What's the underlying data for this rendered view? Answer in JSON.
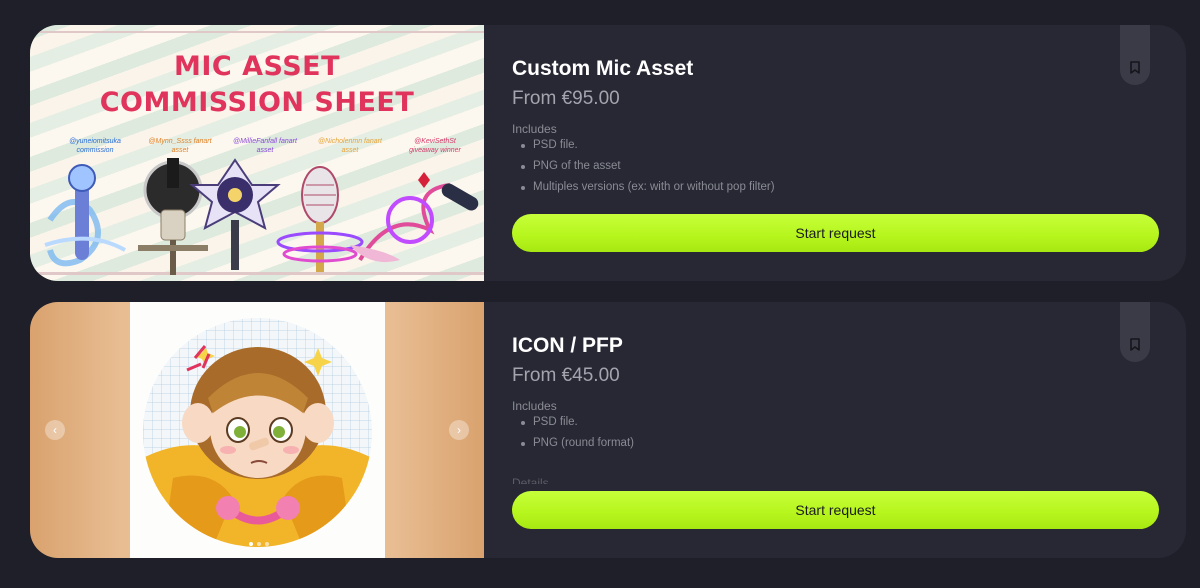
{
  "cards": [
    {
      "title": "Custom Mic Asset",
      "price": "From €95.00",
      "includes_label": "Includes",
      "includes": [
        "PSD file.",
        "PNG of the asset",
        "Multiples versions (ex: with or without pop filter)"
      ],
      "cta_label": "Start request",
      "image": {
        "heading_line1": "MIC ASSET",
        "heading_line2": "COMMISSION SHEET",
        "handles": [
          {
            "text": "@yuneiomitsuka commission",
            "color": "#2d6fd6"
          },
          {
            "text": "@Mynn_Ssss fanart asset",
            "color": "#e0842a"
          },
          {
            "text": "@MillieFanfall fanart asset",
            "color": "#8a4bd6"
          },
          {
            "text": "@Nicholenmn fanart asset",
            "color": "#e6a53a"
          },
          {
            "text": "@KeviSethSt giveaway winner",
            "color": "#d63a6a"
          }
        ]
      }
    },
    {
      "title": "ICON / PFP",
      "price": "From €45.00",
      "includes_label": "Includes",
      "includes": [
        "PSD file.",
        "PNG (round format)"
      ],
      "details_peek": "Details",
      "cta_label": "Start request",
      "carousel": {
        "prev_icon": "‹",
        "next_icon": "›",
        "slides": 3,
        "active": 1
      }
    }
  ],
  "colors": {
    "background": "#1e1f28",
    "card": "#272833",
    "accent": "#b6f51c"
  },
  "icons": {
    "bookmark": "bookmark-icon",
    "prev": "chevron-left-icon",
    "next": "chevron-right-icon"
  }
}
